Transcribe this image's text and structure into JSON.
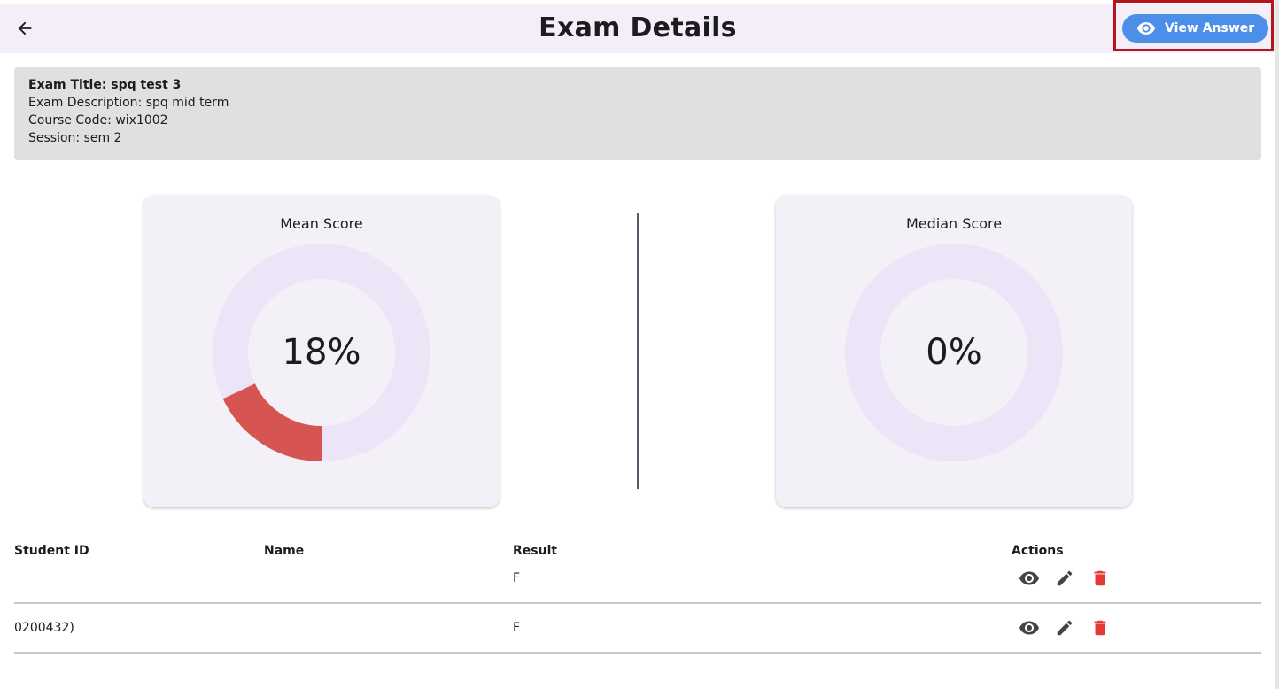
{
  "header": {
    "title": "Exam Details",
    "view_answer_label": "View Answer",
    "back_icon": "arrow-left-icon",
    "accent": "#4b8fe8"
  },
  "exam_info": {
    "title_line": "Exam Title: spq test 3",
    "description_line": "Exam Description: spq mid term",
    "course_line": "Course Code:  wix1002",
    "session_line": "Session: sem 2"
  },
  "stats": {
    "mean": {
      "label": "Mean Score",
      "value_text": "18%",
      "value": 18,
      "color": "#d65553",
      "track": "#ede4f8"
    },
    "median": {
      "label": "Median Score",
      "value_text": "0%",
      "value": 0,
      "color": "#d65553",
      "track": "#ede4f8"
    }
  },
  "table": {
    "headers": [
      "Student ID",
      "Name",
      "Result",
      "Actions"
    ],
    "rows": [
      {
        "student_id": "",
        "name": "",
        "result": "F"
      },
      {
        "student_id": "0200432)",
        "name": "",
        "result": "F"
      }
    ],
    "action_icons": [
      "eye-icon",
      "pencil-icon",
      "trash-icon"
    ],
    "delete_color": "#e53935"
  }
}
